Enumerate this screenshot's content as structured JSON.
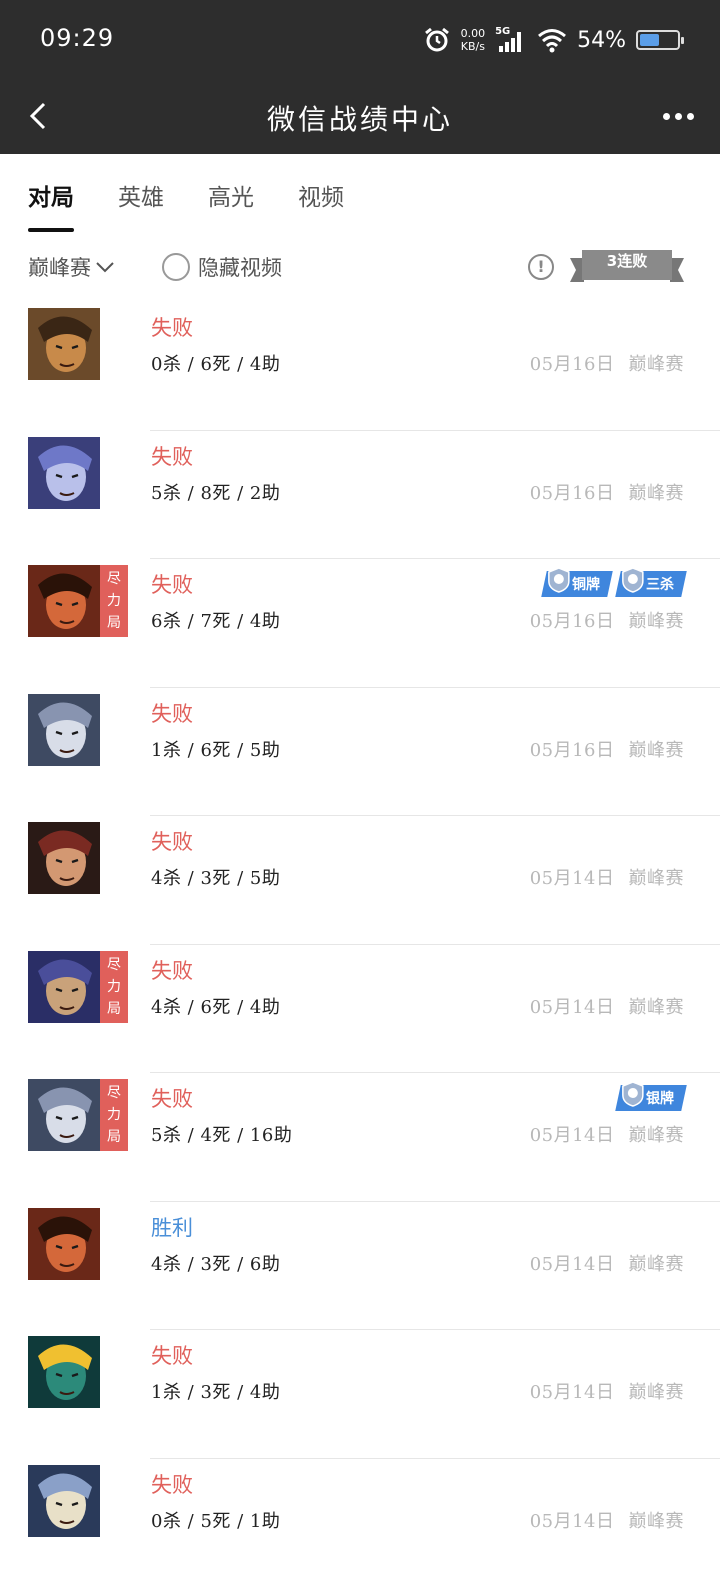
{
  "status_bar": {
    "time": "09:29",
    "net_speed_value": "0.00",
    "net_speed_unit": "KB/s",
    "network": "5G",
    "battery_pct": "54%",
    "battery_level": 0.54,
    "icons": [
      "alarm-icon",
      "signal-icon",
      "wifi-icon",
      "battery-icon"
    ]
  },
  "header": {
    "title": "微信战绩中心",
    "back_icon": "chevron-left-icon",
    "more_icon": "more-icon"
  },
  "tabs": [
    {
      "label": "对局",
      "active": true
    },
    {
      "label": "英雄",
      "active": false
    },
    {
      "label": "高光",
      "active": false
    },
    {
      "label": "视频",
      "active": false
    }
  ],
  "filter": {
    "mode": "巅峰赛",
    "hide_video_label": "隐藏视频",
    "streak_label": "3连败"
  },
  "colors": {
    "header_bg": "#2d2d2d",
    "lose": "#e0605b",
    "win": "#4a8fd8",
    "badge": "#3f86dd",
    "meta": "#b8b8b8"
  },
  "matches": [
    {
      "result": "失败",
      "kda": "0杀 / 6死 / 4助",
      "date": "05月16日",
      "mode": "巅峰赛",
      "effort": "",
      "badges": []
    },
    {
      "result": "失败",
      "kda": "5杀 / 8死 / 2助",
      "date": "05月16日",
      "mode": "巅峰赛",
      "effort": "",
      "badges": []
    },
    {
      "result": "失败",
      "kda": "6杀 / 7死 / 4助",
      "date": "05月16日",
      "mode": "巅峰赛",
      "effort": "尽力局",
      "badges": [
        "铜牌",
        "三杀"
      ]
    },
    {
      "result": "失败",
      "kda": "1杀 / 6死 / 5助",
      "date": "05月16日",
      "mode": "巅峰赛",
      "effort": "",
      "badges": []
    },
    {
      "result": "失败",
      "kda": "4杀 / 3死 / 5助",
      "date": "05月14日",
      "mode": "巅峰赛",
      "effort": "",
      "badges": []
    },
    {
      "result": "失败",
      "kda": "4杀 / 6死 / 4助",
      "date": "05月14日",
      "mode": "巅峰赛",
      "effort": "尽力局",
      "badges": []
    },
    {
      "result": "失败",
      "kda": "5杀 / 4死 / 16助",
      "date": "05月14日",
      "mode": "巅峰赛",
      "effort": "尽力局",
      "badges": [
        "银牌"
      ]
    },
    {
      "result": "胜利",
      "kda": "4杀 / 3死 / 6助",
      "date": "05月14日",
      "mode": "巅峰赛",
      "effort": "",
      "badges": []
    },
    {
      "result": "失败",
      "kda": "1杀 / 3死 / 4助",
      "date": "05月14日",
      "mode": "巅峰赛",
      "effort": "",
      "badges": []
    },
    {
      "result": "失败",
      "kda": "0杀 / 5死 / 1助",
      "date": "05月14日",
      "mode": "巅峰赛",
      "effort": "",
      "badges": []
    }
  ]
}
